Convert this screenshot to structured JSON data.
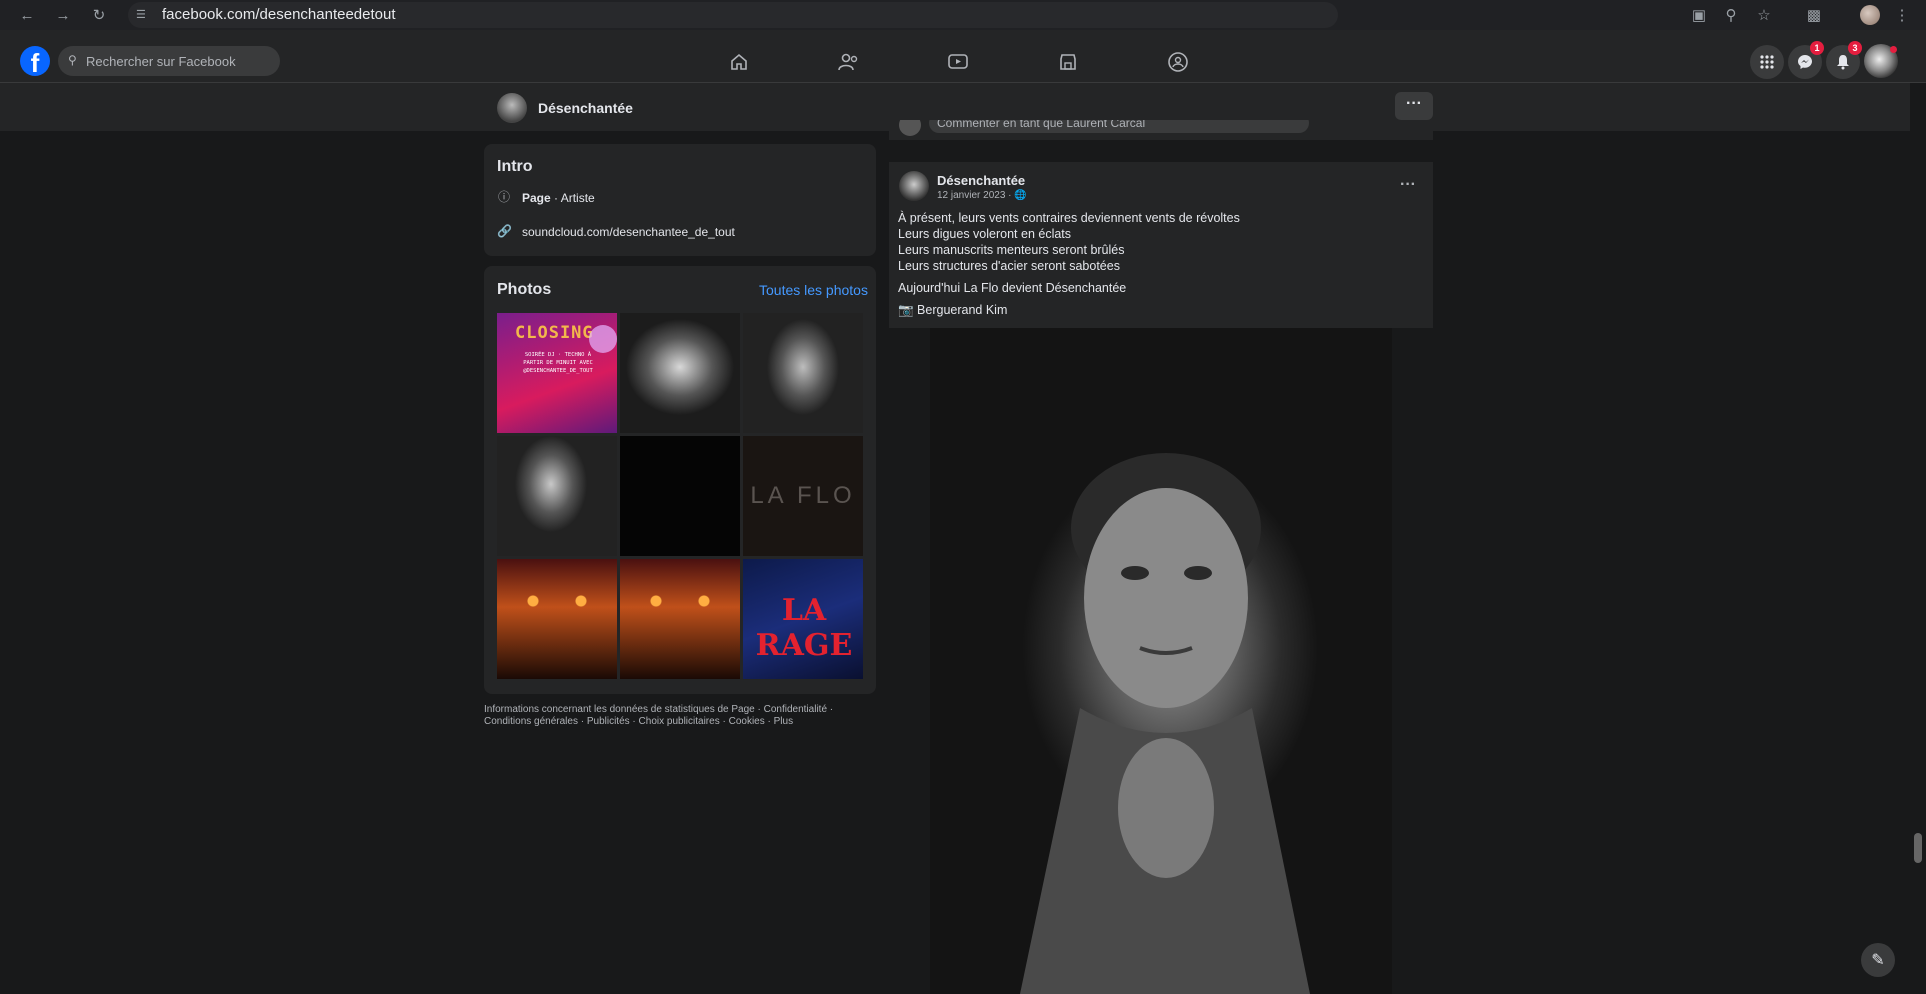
{
  "browser": {
    "url": "facebook.com/desenchanteedetout"
  },
  "facebook": {
    "search_placeholder": "Rechercher sur Facebook",
    "messenger_badge": "1",
    "notifications_badge": "3",
    "nav_icons": [
      "home-icon",
      "friends-icon",
      "video-icon",
      "marketplace-icon",
      "groups-icon"
    ]
  },
  "page": {
    "name": "Désenchantée",
    "more_label": "···"
  },
  "intro": {
    "title": "Intro",
    "category_bold": "Page",
    "category_rest": " · Artiste",
    "link": "soundcloud.com/desenchantee_de_tout"
  },
  "photos": {
    "title": "Photos",
    "see_all": "Toutes les photos",
    "items": [
      {
        "caption": "CLOSING",
        "sub": "SOIRÉE DJ · TECHNO À PARTIR DE MINUIT AVEC @DESENCHANTEE_DE_TOUT"
      },
      {
        "caption": ""
      },
      {
        "caption": ""
      },
      {
        "caption": ""
      },
      {
        "caption": ""
      },
      {
        "caption": "LA FLO"
      },
      {
        "caption": ""
      },
      {
        "caption": ""
      },
      {
        "caption": "LA RAGE"
      }
    ]
  },
  "footer": {
    "links": [
      "Informations concernant les données de statistiques de Page",
      "Confidentialité",
      "Conditions générales",
      "Publicités",
      "Choix publicitaires",
      "Cookies",
      "Plus"
    ]
  },
  "post": {
    "comment_placeholder": "Commenter en tant que Laurent Carcal",
    "author": "Désenchantée",
    "date": "12 janvier 2023 · ",
    "more": "···",
    "lines": [
      "À présent, leurs vents contraires deviennent vents de révoltes",
      "Leurs digues voleront en éclats",
      "Leurs manuscrits menteurs seront brûlés",
      "Leurs structures d'acier seront sabotées"
    ],
    "line2": "Aujourd'hui La Flo devient Désenchantée",
    "credit": "📷 Berguerand Kim"
  }
}
